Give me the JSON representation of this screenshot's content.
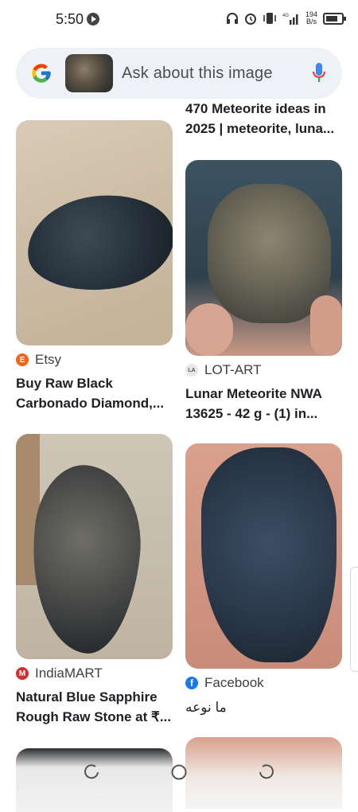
{
  "status_bar": {
    "time": "5:50",
    "net_speed_value": "194",
    "net_speed_unit": "B/s",
    "network": "4G"
  },
  "search": {
    "placeholder": "Ask about this image"
  },
  "results": [
    {
      "title_line1": "470 Meteorite ideas in",
      "title_line2": "2025 | meteorite, luna..."
    },
    {
      "source": "Etsy",
      "source_icon": "etsy-icon",
      "title_line1": "Buy Raw Black",
      "title_line2": "Carbonado Diamond,..."
    },
    {
      "source": "LOT-ART",
      "source_icon": "lotart-icon",
      "title_line1": "Lunar Meteorite NWA",
      "title_line2": "13625 - 42 g - (1) in..."
    },
    {
      "source": "IndiaMART",
      "source_icon": "indiamart-icon",
      "title_line1": "Natural Blue Sapphire",
      "title_line2": "Rough Raw Stone at ₹..."
    },
    {
      "source": "Facebook",
      "source_icon": "facebook-icon",
      "title_line1": "ما نوعه"
    }
  ],
  "colors": {
    "search_bg": "#eef1f5",
    "etsy": "#f1641e",
    "facebook": "#1877f2",
    "indiamart": "#d32f2f"
  }
}
